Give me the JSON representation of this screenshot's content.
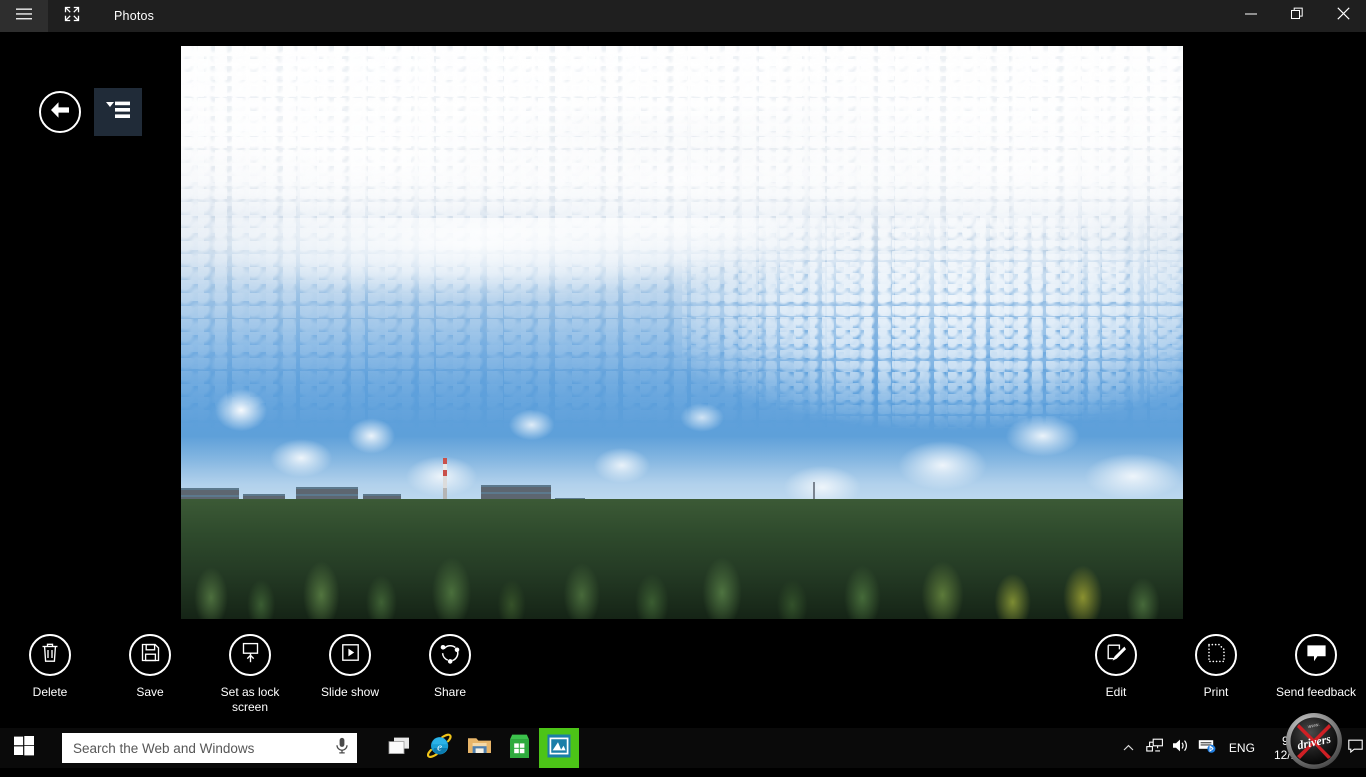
{
  "window": {
    "title": "Photos",
    "hamburger_icon": "hamburger-menu-icon",
    "fullscreen_icon": "fullscreen-expand-icon",
    "minimize_icon": "minimize-icon",
    "restore_icon": "restore-icon",
    "close_icon": "close-icon",
    "titlebar_bg": "#1f1f1f"
  },
  "overlay": {
    "back_icon": "back-arrow-icon",
    "back_label": "Back",
    "list_icon": "list-view-icon",
    "list_label": "View options",
    "list_btn_bg": "#202b38"
  },
  "photo": {
    "alt": "City skyline with apartment blocks behind a treeline under a blue sky with scattered and altocumulus clouds",
    "sky_blue": "#5c9fdb",
    "cloud_white": "#ffffff",
    "tree_green": "#2e4a2c",
    "building_gray": "#5d6670"
  },
  "appbar": {
    "commands_left": [
      {
        "id": "delete",
        "label": "Delete",
        "icon": "trash-icon"
      },
      {
        "id": "save",
        "label": "Save",
        "icon": "save-floppy-icon"
      },
      {
        "id": "set-lock-screen",
        "label": "Set as lock\nscreen",
        "icon": "lock-screen-icon"
      },
      {
        "id": "slide-show",
        "label": "Slide show",
        "icon": "slideshow-play-icon"
      },
      {
        "id": "share",
        "label": "Share",
        "icon": "share-icon"
      }
    ],
    "commands_right": [
      {
        "id": "edit",
        "label": "Edit",
        "icon": "edit-pencil-icon"
      },
      {
        "id": "print",
        "label": "Print",
        "icon": "print-dotted-page-icon"
      },
      {
        "id": "send-feedback",
        "label": "Send feedback",
        "icon": "feedback-speech-bubble-icon"
      }
    ]
  },
  "taskbar": {
    "start_icon": "windows-start-icon",
    "start_label": "Start",
    "search_placeholder": "Search the Web and Windows",
    "search_value": "",
    "mic_icon": "microphone-icon",
    "apps": [
      {
        "id": "task-view",
        "icon": "task-view-icon",
        "label": "Task View",
        "active": false
      },
      {
        "id": "internet-explorer",
        "icon": "internet-explorer-icon",
        "label": "Internet Explorer",
        "active": false
      },
      {
        "id": "file-explorer",
        "icon": "file-explorer-icon",
        "label": "File Explorer",
        "active": false
      },
      {
        "id": "store",
        "icon": "windows-store-icon",
        "label": "Store",
        "active": false
      },
      {
        "id": "photos",
        "icon": "photos-app-icon",
        "label": "Photos",
        "active": true
      }
    ],
    "tray": {
      "chevron_icon": "show-hidden-icons-chevron",
      "network_icon": "network-icon",
      "volume_icon": "volume-speaker-icon",
      "bluetooth_icon": "bluetooth-device-icon",
      "language": "ENG",
      "time": "9:14 AM",
      "date": "12/16/2014",
      "action_center_icon": "action-center-icon"
    },
    "active_highlight": "#4cc417",
    "bg": "#0a0a0a"
  },
  "watermark": {
    "text": "drivers",
    "icon": "drivers-logo-watermark"
  }
}
